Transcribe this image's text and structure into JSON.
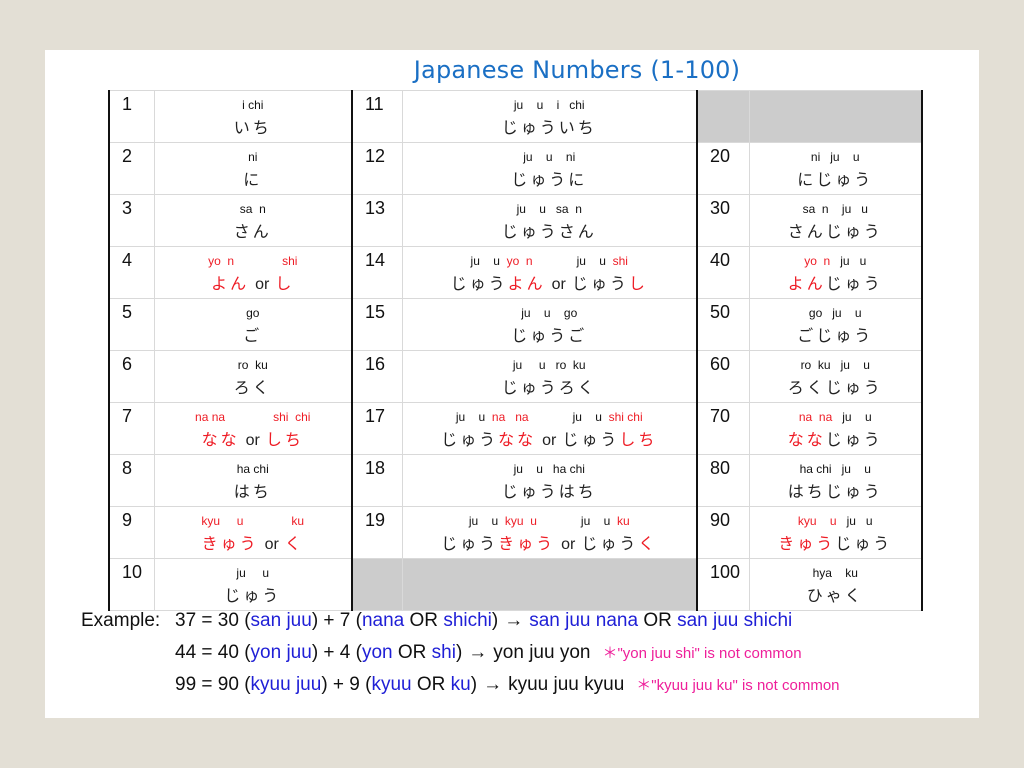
{
  "title": "Japanese Numbers (1-100)",
  "colors": {
    "title": "#1a6fc4",
    "highlight_red": "#ee1c25",
    "example_blue": "#1f1fd6",
    "note_magenta": "#ee1f9a",
    "blank_cell": "#cccccc"
  },
  "table": {
    "rows": [
      {
        "a_num": "1",
        "a_romaji": "i chi",
        "a_kana": "いち",
        "b_num": "11",
        "b_romaji": "ju    u    i   chi",
        "b_kana": "じゅういち",
        "c_num": "",
        "c_romaji": "",
        "c_kana": ""
      },
      {
        "a_num": "2",
        "a_romaji": "ni",
        "a_kana": "に",
        "b_num": "12",
        "b_romaji": "ju    u    ni",
        "b_kana": "じゅうに",
        "c_num": "20",
        "c_romaji": "ni   ju    u",
        "c_kana": "にじゅう"
      },
      {
        "a_num": "3",
        "a_romaji": "sa  n",
        "a_kana": "さん",
        "b_num": "13",
        "b_romaji": "ju    u   sa  n",
        "b_kana": "じゅうさん",
        "c_num": "30",
        "c_romaji": "sa  n    ju   u",
        "c_kana": "さんじゅう"
      },
      {
        "a_num": "4",
        "a_romaji_1": "yo  n",
        "a_romaji_2": "shi",
        "a_kana_1": "よん",
        "a_or": "or",
        "a_kana_2": "し",
        "b_num": "14",
        "b_romaji_p1": "ju    u  ",
        "b_romaji_r1": "yo  n",
        "b_romaji_p2": "ju    u  ",
        "b_romaji_r2": "shi",
        "b_kana_p1": "じゅう",
        "b_kana_r1": "よん",
        "b_or": "or",
        "b_kana_p2": "じゅう",
        "b_kana_r2": "し",
        "c_num": "40",
        "c_romaji_r": "yo  n",
        "c_romaji_p": "ju   u",
        "c_kana_r": "よん",
        "c_kana_p": "じゅう"
      },
      {
        "a_num": "5",
        "a_romaji": "go",
        "a_kana": "ご",
        "b_num": "15",
        "b_romaji": "ju    u    go",
        "b_kana": "じゅうご",
        "c_num": "50",
        "c_romaji": "go   ju    u",
        "c_kana": "ごじゅう"
      },
      {
        "a_num": "6",
        "a_romaji": "ro  ku",
        "a_kana": "ろく",
        "b_num": "16",
        "b_romaji": "ju     u   ro  ku",
        "b_kana": "じゅうろく",
        "c_num": "60",
        "c_romaji": "ro  ku   ju    u",
        "c_kana": "ろくじゅう"
      },
      {
        "a_num": "7",
        "a_romaji_1": "na na",
        "a_romaji_2": "shi  chi",
        "a_kana_1": "なな",
        "a_or": "or",
        "a_kana_2": "しち",
        "b_num": "17",
        "b_romaji_p1": "ju    u  ",
        "b_romaji_r1": "na   na",
        "b_romaji_p2": "ju    u  ",
        "b_romaji_r2": "shi chi",
        "b_kana_p1": "じゅう",
        "b_kana_r1": "なな",
        "b_or": "or",
        "b_kana_p2": "じゅう",
        "b_kana_r2": "しち",
        "c_num": "70",
        "c_romaji_r": "na  na",
        "c_romaji_p": "ju    u",
        "c_kana_r": "なな",
        "c_kana_p": "じゅう"
      },
      {
        "a_num": "8",
        "a_romaji": "ha chi",
        "a_kana": "はち",
        "b_num": "18",
        "b_romaji": "ju    u   ha chi",
        "b_kana": "じゅうはち",
        "c_num": "80",
        "c_romaji": "ha chi   ju    u",
        "c_kana": "はちじゅう"
      },
      {
        "a_num": "9",
        "a_romaji_1": "kyu     u",
        "a_romaji_2": "ku",
        "a_kana_1": "きゅう",
        "a_or": "or",
        "a_kana_2": "く",
        "b_num": "19",
        "b_romaji_p1": "ju    u  ",
        "b_romaji_r1": "kyu  u",
        "b_romaji_p2": "ju    u  ",
        "b_romaji_r2": "ku",
        "b_kana_p1": "じゅう",
        "b_kana_r1": "きゅう",
        "b_or": "or",
        "b_kana_p2": "じゅう",
        "b_kana_r2": "く",
        "c_num": "90",
        "c_romaji_r": "kyu    u",
        "c_romaji_p": "ju   u",
        "c_kana_r": "きゅう",
        "c_kana_p": "じゅう"
      },
      {
        "a_num": "10",
        "a_romaji": "ju     u",
        "a_kana": "じゅう",
        "b_num": "",
        "b_romaji": "",
        "b_kana": "",
        "c_num": "100",
        "c_romaji": "hya    ku",
        "c_kana": "ひゃく"
      }
    ]
  },
  "examples": {
    "label": "Example:",
    "lines": [
      {
        "p1": "37 = 30 (",
        "b1": "san juu",
        "p2": ") + 7 (",
        "b2": "nana",
        "p3": " OR ",
        "b3": "shichi",
        "p4": ")",
        "arrow": "→",
        "result_b1": "san juu nana",
        "result_p": " OR ",
        "result_b2": "san juu shichi",
        "note": ""
      },
      {
        "p1": "44 = 40 (",
        "b1": "yon juu",
        "p2": ") + 4 (",
        "b2": "yon",
        "p3": " OR ",
        "b3": "shi",
        "p4": ")",
        "arrow": "→",
        "result": "yon juu yon",
        "note": "＊\"yon juu shi\" is not common"
      },
      {
        "p1": "99 = 90 (",
        "b1": "kyuu juu",
        "p2": ") + 9 (",
        "b2": "kyuu",
        "p3": " OR ",
        "b3": "ku",
        "p4": ")",
        "arrow": "→",
        "result": "kyuu juu kyuu",
        "note": "＊\"kyuu juu ku\" is not common"
      }
    ]
  }
}
